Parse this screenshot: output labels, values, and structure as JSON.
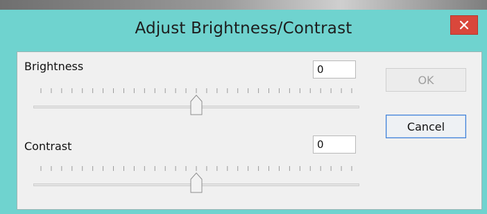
{
  "window": {
    "title": "Adjust Brightness/Contrast",
    "close_icon": "close-icon"
  },
  "brightness": {
    "label": "Brightness",
    "value": "0",
    "slider_level_fraction": 0.5
  },
  "contrast": {
    "label": "Contrast",
    "value": "0",
    "slider_level_fraction": 0.5
  },
  "buttons": {
    "ok_label": "OK",
    "cancel_label": "Cancel"
  },
  "colors": {
    "titlebar": "#6fd3cf",
    "close_button": "#d9473b",
    "client_background": "#f0f0f0",
    "default_button_border": "#3d7fd8"
  }
}
